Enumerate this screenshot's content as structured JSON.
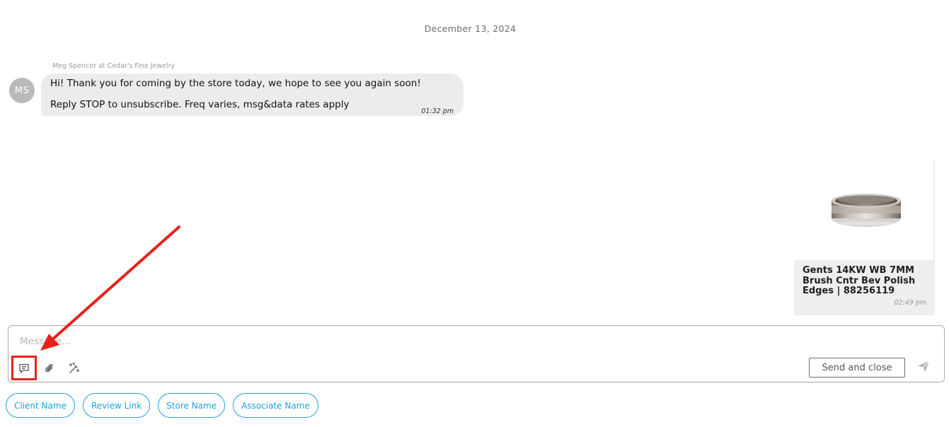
{
  "conversation": {
    "date_divider": "December 13, 2024",
    "incoming": {
      "sender_name": "Meg Spencer at Cedar's Fine Jewelry",
      "avatar_initials": "MS",
      "line1": "Hi! Thank you for coming by the store today, we hope to see you again soon!",
      "line2": "Reply STOP to unsubscribe. Freq varies, msg&data rates apply",
      "time": "01:32 pm"
    },
    "product_card": {
      "title": "Gents 14KW WB 7MM Brush Cntr Bev Polish Edges | 88256119",
      "time": "02:49 pm",
      "image": "ring-product-photo"
    }
  },
  "composer": {
    "placeholder": "Message...",
    "value": "",
    "tools": [
      {
        "icon": "message-template-icon"
      },
      {
        "icon": "paperclip-icon"
      },
      {
        "icon": "magic-wand-icon"
      }
    ],
    "send_close_label": "Send and close",
    "send_icon": "send-icon"
  },
  "chips": [
    "Client Name",
    "Review Link",
    "Store Name",
    "Associate Name"
  ],
  "colors": {
    "annotation_red": "#e8211a",
    "chip_blue": "#1ea3d8",
    "bubble_gray": "#ececec"
  }
}
